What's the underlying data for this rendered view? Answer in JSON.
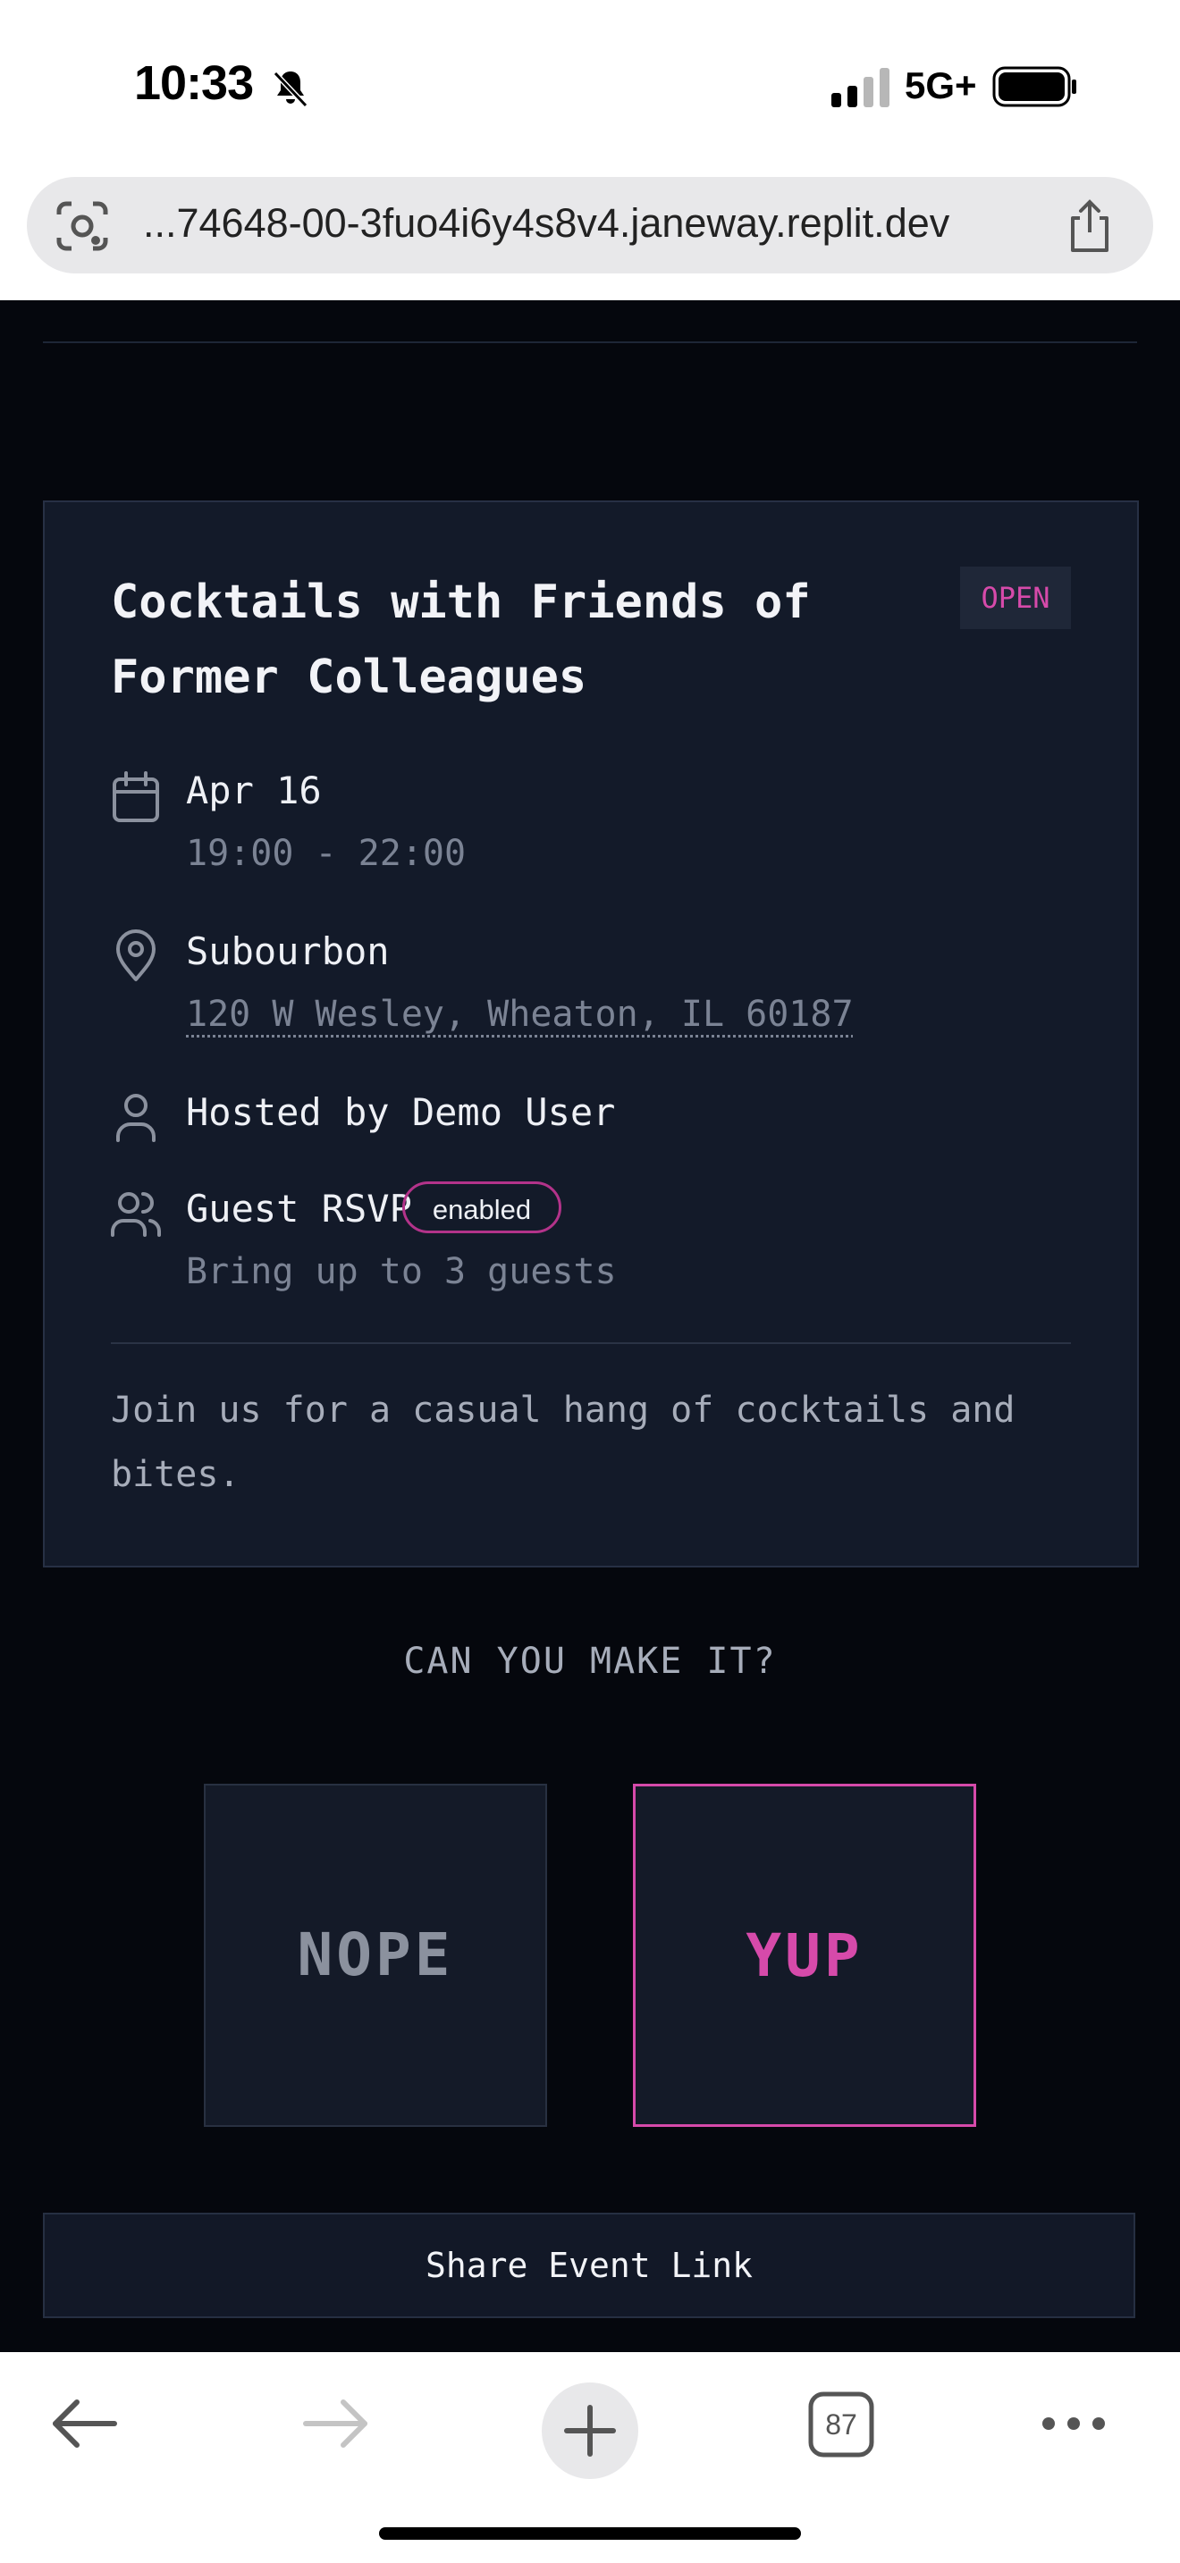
{
  "status_bar": {
    "time": "10:33",
    "network": "5G+"
  },
  "browser": {
    "url": "...74648-00-3fuo4i6y4s8v4.janeway.replit.dev",
    "tab_count": "87"
  },
  "event": {
    "title": "Cocktails with Friends of Former Colleagues",
    "status": "OPEN",
    "date": "Apr 16",
    "time_range": "19:00 - 22:00",
    "venue": "Subourbon",
    "address": "120 W Wesley, Wheaton, IL 60187",
    "host": "Hosted by Demo User",
    "guest_rsvp_label": "Guest RSVP",
    "guest_rsvp_state": "enabled",
    "guest_limit": "Bring up to 3 guests",
    "description": "Join us for a casual hang of cocktails and bites."
  },
  "rsvp": {
    "question": "CAN YOU MAKE IT?",
    "no_label": "NOPE",
    "yes_label": "YUP"
  },
  "share": {
    "label": "Share Event Link"
  },
  "colors": {
    "accent": "#d64aaa",
    "background": "#05070d",
    "card": "#131a29"
  }
}
